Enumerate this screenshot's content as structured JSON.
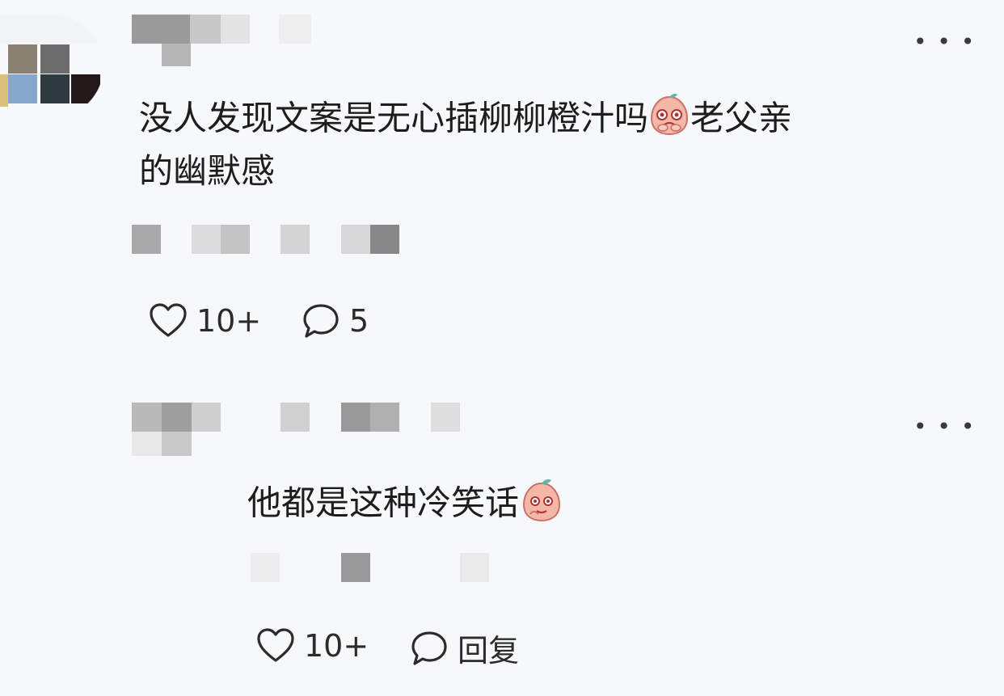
{
  "comments": [
    {
      "text_line1": "没人发现文案是无心插柳柳橙汁吗",
      "text_line1_suffix": "老父亲",
      "text_line2": "的幽默感",
      "emoji": "crying-peach-emoji",
      "likes": "10+",
      "replies": "5",
      "more_label": "• • •"
    },
    {
      "text": "他都是这种冷笑话",
      "emoji": "smiling-peach-emoji",
      "likes": "10+",
      "reply_label": "回复",
      "more_label": "• • •"
    }
  ],
  "colors": {
    "background": "#f7f8fa",
    "text": "#1d1d1d",
    "icon": "#2b2b2b",
    "emoji_skin": "#f4b7a6",
    "emoji_leaf": "#5fb5b0"
  }
}
